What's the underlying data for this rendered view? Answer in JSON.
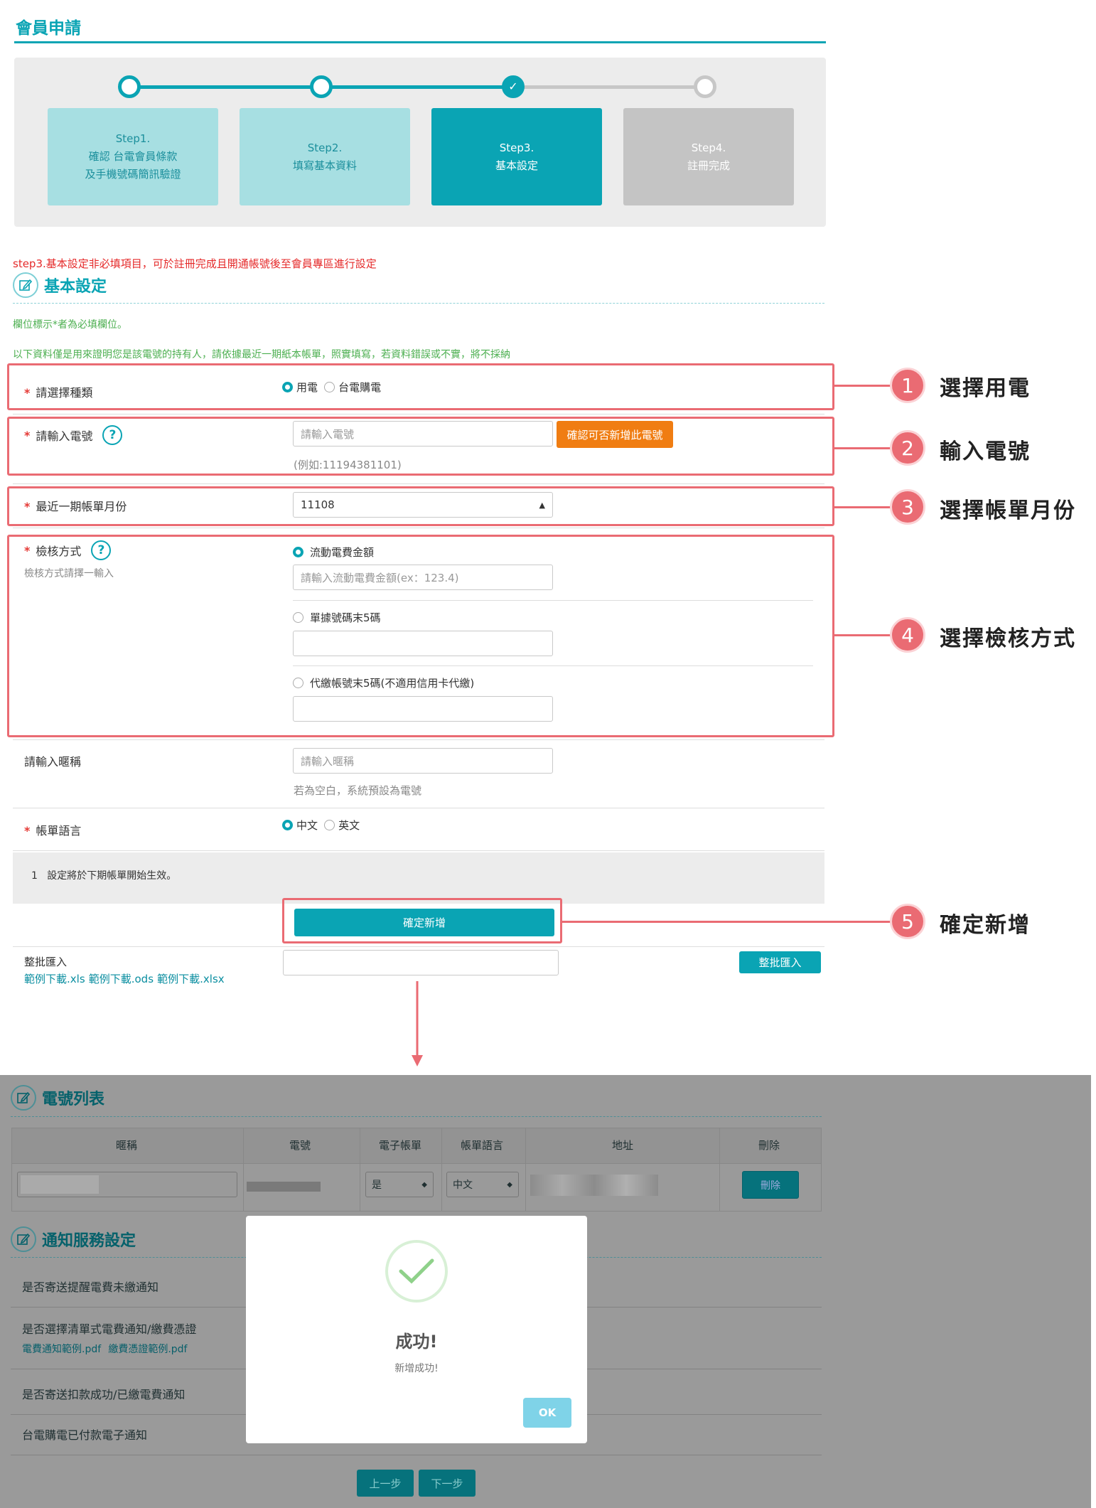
{
  "page_title": "會員申請",
  "steps": [
    {
      "label": "Step1.\n確認 台電會員條款\n及手機號碼簡訊驗證",
      "state": "passed"
    },
    {
      "label": "Step2.\n填寫基本資料",
      "state": "passed"
    },
    {
      "label": "Step3.\n基本設定",
      "state": "active"
    },
    {
      "label": "Step4.\n註冊完成",
      "state": "pending"
    }
  ],
  "notice": "step3.基本設定非必填項目，可於註冊完成且開通帳號後至會員專區進行設定",
  "basic_section": {
    "title": "基本設定",
    "required_note": "欄位標示*者為必填欄位。",
    "info_note": "以下資料僅是用來證明您是該電號的持有人，請依據最近一期紙本帳單，照實填寫，若資料錯誤或不實，將不採納"
  },
  "form": {
    "required_mark": "*",
    "category": {
      "label": "請選擇種類",
      "options": [
        "用電",
        "台電購電"
      ],
      "selected": "用電"
    },
    "meter": {
      "label": "請輸入電號",
      "placeholder": "請輸入電號",
      "check_button": "確認可否新增此電號",
      "example": "(例如:11194381101)"
    },
    "bill_month": {
      "label": "最近一期帳單月份",
      "value": "11108"
    },
    "verify": {
      "label": "檢核方式",
      "sublabel": "檢核方式請擇一輸入",
      "options": [
        {
          "label": "流動電費金額",
          "placeholder": "請輸入流動電費金額(ex：123.4)",
          "selected": true
        },
        {
          "label": "單據號碼末5碼",
          "placeholder": "",
          "selected": false
        },
        {
          "label": "代繳帳號末5碼(不適用信用卡代繳)",
          "placeholder": "",
          "selected": false
        }
      ]
    },
    "nickname": {
      "label": "請輸入暱稱",
      "placeholder": "請輸入暱稱",
      "hint": "若為空白，系統預設為電號"
    },
    "language": {
      "label": "帳單語言",
      "options": [
        "中文",
        "英文"
      ],
      "selected": "中文"
    },
    "info_box": "1   設定將於下期帳單開始生效。",
    "submit": "確定新增",
    "batch": {
      "label": "整批匯入",
      "button": "整批匯入",
      "links": [
        "範例下載.xls",
        "範例下載.ods",
        "範例下載.xlsx"
      ]
    }
  },
  "callouts": [
    {
      "num": "1",
      "text": "選擇用電"
    },
    {
      "num": "2",
      "text": "輸入電號"
    },
    {
      "num": "3",
      "text": "選擇帳單月份"
    },
    {
      "num": "4",
      "text": "選擇檢核方式"
    },
    {
      "num": "5",
      "text": "確定新增"
    }
  ],
  "meter_list": {
    "title": "電號列表",
    "columns": [
      "暱稱",
      "電號",
      "電子帳單",
      "帳單語言",
      "地址",
      "刪除"
    ],
    "row": {
      "ebill": "是",
      "language": "中文",
      "delete": "刪除"
    }
  },
  "notify_section": {
    "title": "通知服務設定",
    "items": [
      {
        "text": "是否寄送提醒電費未繳通知"
      },
      {
        "text": "是否選擇清單式電費通知/繳費憑證",
        "links": [
          "電費通知範例.pdf",
          "繳費憑證範例.pdf"
        ]
      },
      {
        "text": "是否寄送扣款成功/已繳電費通知"
      },
      {
        "text": "台電購電已付款電子通知"
      }
    ]
  },
  "nav": {
    "prev": "上一步",
    "next": "下一步"
  },
  "modal": {
    "title": "成功!",
    "message": "新增成功!",
    "ok": "OK"
  },
  "colors": {
    "accent": "#0aa4b4",
    "callout": "#ea6b73",
    "required": "#e53935",
    "orange": "#f07d12"
  }
}
